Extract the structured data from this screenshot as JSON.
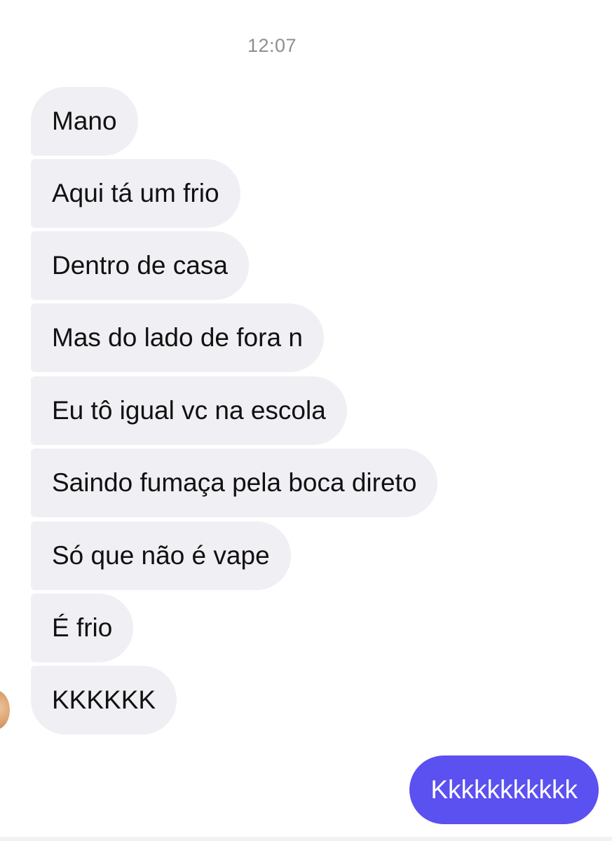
{
  "conversation": {
    "timestamp": "12:07",
    "received": [
      "Mano",
      "Aqui tá um frio",
      "Dentro de casa",
      "Mas do lado de fora n",
      "Eu tô igual vc na escola",
      "Saindo fumaça pela boca direto",
      "Só que não é vape",
      "É frio",
      "KKKKKK"
    ],
    "sent": [
      "Kkkkkkkkkkk"
    ]
  },
  "colors": {
    "received_bubble": "#efeff4",
    "sent_bubble": "#5b50f0",
    "timestamp_text": "#8e8e93"
  }
}
